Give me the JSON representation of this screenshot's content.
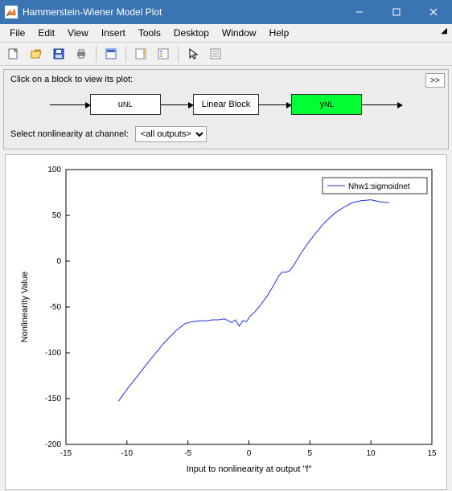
{
  "window": {
    "title": "Hammerstein-Wiener Model Plot"
  },
  "menu": {
    "items": [
      "File",
      "Edit",
      "View",
      "Insert",
      "Tools",
      "Desktop",
      "Window",
      "Help"
    ]
  },
  "toolbar": {
    "new": "New Figure",
    "open": "Open",
    "save": "Save",
    "print": "Print",
    "reuse": "Link Plot",
    "insert_colorbar": "Insert Colorbar",
    "insert_legend": "Insert Legend",
    "pointer": "Edit Plot",
    "property": "Open Property Inspector"
  },
  "diagram": {
    "hint": "Click on a block to view its plot:",
    "u_block": "u",
    "u_sub": "NL",
    "linear_block": "Linear Block",
    "y_block": "y",
    "y_sub": "NL"
  },
  "selector": {
    "label": "Select nonlinearity at channel:",
    "value": "<all outputs>",
    "options": [
      "<all outputs>"
    ]
  },
  "chart_data": {
    "type": "line",
    "title": "",
    "xlabel": "Input to nonlinearity at output \"f\"",
    "ylabel": "Nonlinearity Value",
    "xlim": [
      -15,
      15
    ],
    "xticks": [
      -15,
      -10,
      -5,
      0,
      5,
      10,
      15
    ],
    "ylim": [
      -200,
      100
    ],
    "yticks": [
      -200,
      -150,
      -100,
      -50,
      0,
      50,
      100
    ],
    "legend": {
      "position": "northeast",
      "entries": [
        "Nhw1:sigmoidnet"
      ]
    },
    "series": [
      {
        "name": "Nhw1:sigmoidnet",
        "x": [
          -10.7,
          -10,
          -9,
          -8,
          -7,
          -6,
          -5.2,
          -4.6,
          -4.0,
          -3.4,
          -3.0,
          -2.5,
          -2.0,
          -1.7,
          -1.4,
          -1.1,
          -0.8,
          -0.5,
          -0.2,
          0.1,
          0.5,
          1.0,
          1.5,
          2.0,
          2.4,
          2.7,
          3.0,
          3.3,
          3.7,
          4.2,
          4.8,
          5.5,
          6.2,
          7.0,
          7.8,
          8.5,
          9.2,
          10.0,
          10.7,
          11.2,
          11.5
        ],
        "y": [
          -153,
          -140,
          -123,
          -106,
          -90,
          -76,
          -68,
          -66,
          -65,
          -65,
          -64,
          -64,
          -63,
          -65,
          -67,
          -64,
          -71,
          -65,
          -66,
          -60,
          -55,
          -47,
          -38,
          -27,
          -17,
          -12,
          -12,
          -11,
          -4,
          7,
          19,
          31,
          42,
          52,
          59,
          64,
          66,
          67,
          65,
          64,
          64
        ]
      }
    ]
  }
}
